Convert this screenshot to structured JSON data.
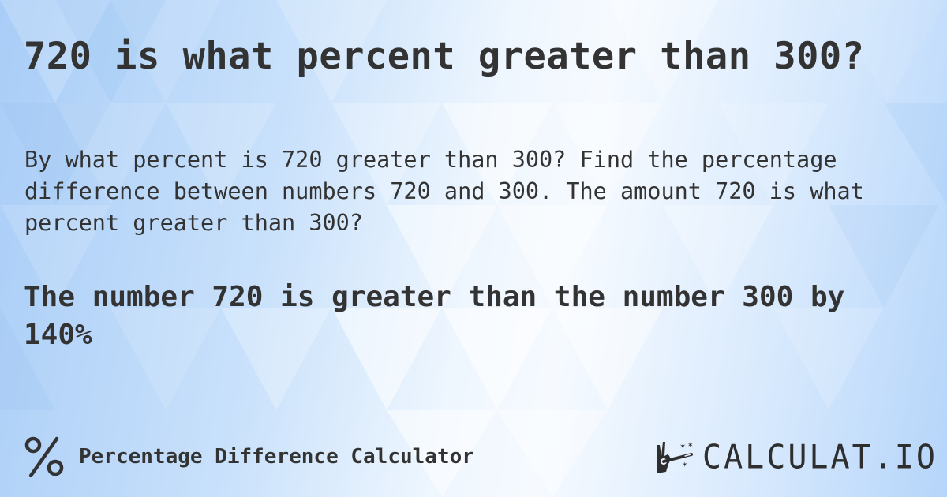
{
  "page": {
    "title": "720 is what percent greater than 300?",
    "description": "By what percent is 720 greater than 300? Find the percentage difference between numbers 720 and 300. The amount 720 is what percent greater than 300?",
    "answer": "The number 720 is greater than the number 300 by 140%"
  },
  "footer": {
    "calculator_icon": "percent-icon",
    "calculator_name": "Percentage Difference Calculator",
    "logo_icon": "hand-magic-wand-icon",
    "logo_text": "CALCULAT.IO"
  },
  "colors": {
    "text": "#333333",
    "background_blue": "#a9cdf7",
    "background_light": "#f6faff"
  }
}
